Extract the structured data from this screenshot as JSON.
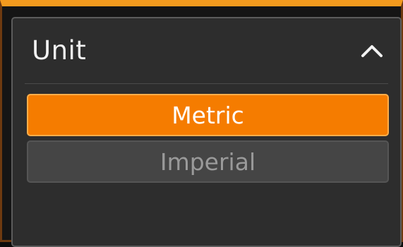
{
  "panel": {
    "title": "Unit",
    "collapse_icon": "chevron-up-icon"
  },
  "options": [
    {
      "label": "Metric",
      "selected": true
    },
    {
      "label": "Imperial",
      "selected": false
    }
  ],
  "colors": {
    "accent": "#f57c00",
    "panel_bg": "#2d2d2d",
    "unselected_bg": "#454545",
    "title_text": "#f2f2f2",
    "unselected_text": "#9a9a9a"
  }
}
